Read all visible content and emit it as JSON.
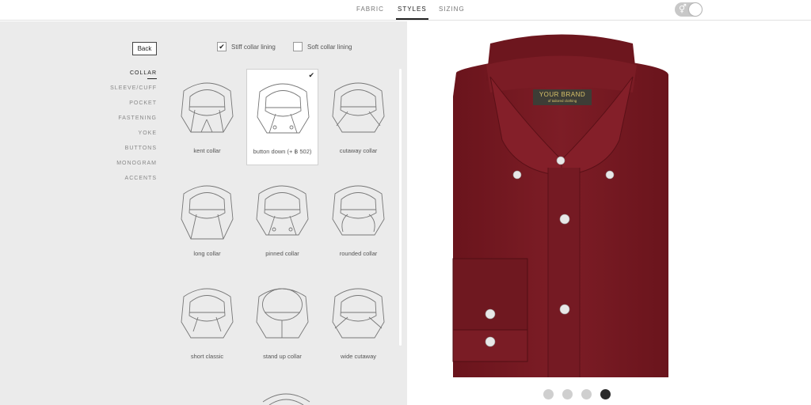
{
  "nav": {
    "tabs": [
      {
        "label": "FABRIC"
      },
      {
        "label": "STYLES"
      },
      {
        "label": "SIZING"
      }
    ],
    "active_tab": "STYLES",
    "toggle_symbol": "⚥"
  },
  "sidebar": {
    "back_label": "Back",
    "categories": [
      {
        "label": "COLLAR"
      },
      {
        "label": "SLEEVE/CUFF"
      },
      {
        "label": "POCKET"
      },
      {
        "label": "FASTENING"
      },
      {
        "label": "YOKE"
      },
      {
        "label": "BUTTONS"
      },
      {
        "label": "MONOGRAM"
      },
      {
        "label": "ACCENTS"
      }
    ],
    "active_category": "COLLAR"
  },
  "options": {
    "stiff": {
      "label": "Stiff collar lining",
      "checked": true
    },
    "soft": {
      "label": "Soft collar lining",
      "checked": false
    }
  },
  "collars": [
    {
      "label": "kent collar",
      "selected": false,
      "icon": "kent-collar-icon"
    },
    {
      "label": "button down (+ ฿ 502)",
      "selected": true,
      "icon": "button-down-collar-icon"
    },
    {
      "label": "cutaway collar",
      "selected": false,
      "icon": "cutaway-collar-icon"
    },
    {
      "label": "long collar",
      "selected": false,
      "icon": "long-collar-icon"
    },
    {
      "label": "pinned collar",
      "selected": false,
      "icon": "pinned-collar-icon"
    },
    {
      "label": "rounded collar",
      "selected": false,
      "icon": "rounded-collar-icon"
    },
    {
      "label": "short classic",
      "selected": false,
      "icon": "short-classic-collar-icon"
    },
    {
      "label": "stand up collar",
      "selected": false,
      "icon": "stand-up-collar-icon"
    },
    {
      "label": "wide cutaway",
      "selected": false,
      "icon": "wide-cutaway-collar-icon"
    }
  ],
  "shirt": {
    "brand_title": "YOUR BRAND",
    "brand_subtitle": "of tailored clothing",
    "color": "#7a1a22",
    "color_dark": "#5e1219",
    "color_light": "#8b2530"
  },
  "preview": {
    "view_count": 4,
    "active_view": 4
  }
}
